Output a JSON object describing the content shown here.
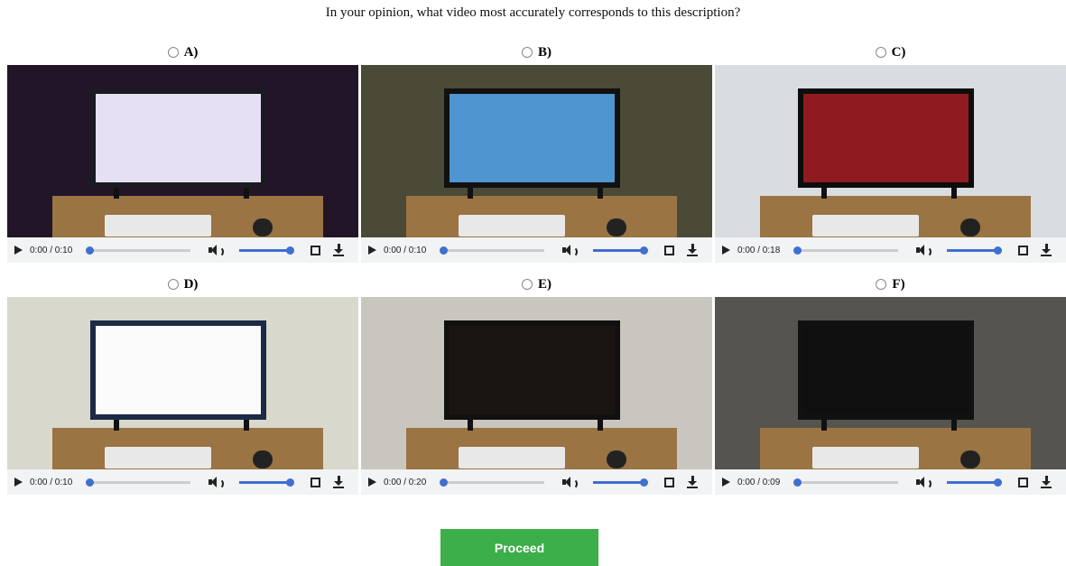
{
  "question": "In your opinion, what video most accurately corresponds to this description?",
  "options": [
    {
      "label": "A)",
      "time": "0:00 / 0:10",
      "progress": 0,
      "bg": "#231528",
      "screen": "#e6e0f5",
      "frame": "#1a1a22"
    },
    {
      "label": "B)",
      "time": "0:00 / 0:10",
      "progress": 0,
      "bg": "#4a4a36",
      "screen": "#4f95cf",
      "frame": "#111111"
    },
    {
      "label": "C)",
      "time": "0:00 / 0:18",
      "progress": 0,
      "bg": "#d9dce0",
      "screen": "#8f1a1f",
      "frame": "#0d0d0d"
    },
    {
      "label": "D)",
      "time": "0:00 / 0:10",
      "progress": 0,
      "bg": "#d8d8cc",
      "screen": "#fbfbfb",
      "frame": "#1c2a48"
    },
    {
      "label": "E)",
      "time": "0:00 / 0:20",
      "progress": 0,
      "bg": "#c9c6bf",
      "screen": "#1b1512",
      "frame": "#111111"
    },
    {
      "label": "F)",
      "time": "0:00 / 0:09",
      "progress": 0,
      "bg": "#55544e",
      "screen": "#0f0f0f",
      "frame": "#111111"
    }
  ],
  "proceed_label": "Proceed",
  "icons": [
    "play-icon",
    "volume-icon",
    "fullscreen-icon",
    "download-icon"
  ]
}
